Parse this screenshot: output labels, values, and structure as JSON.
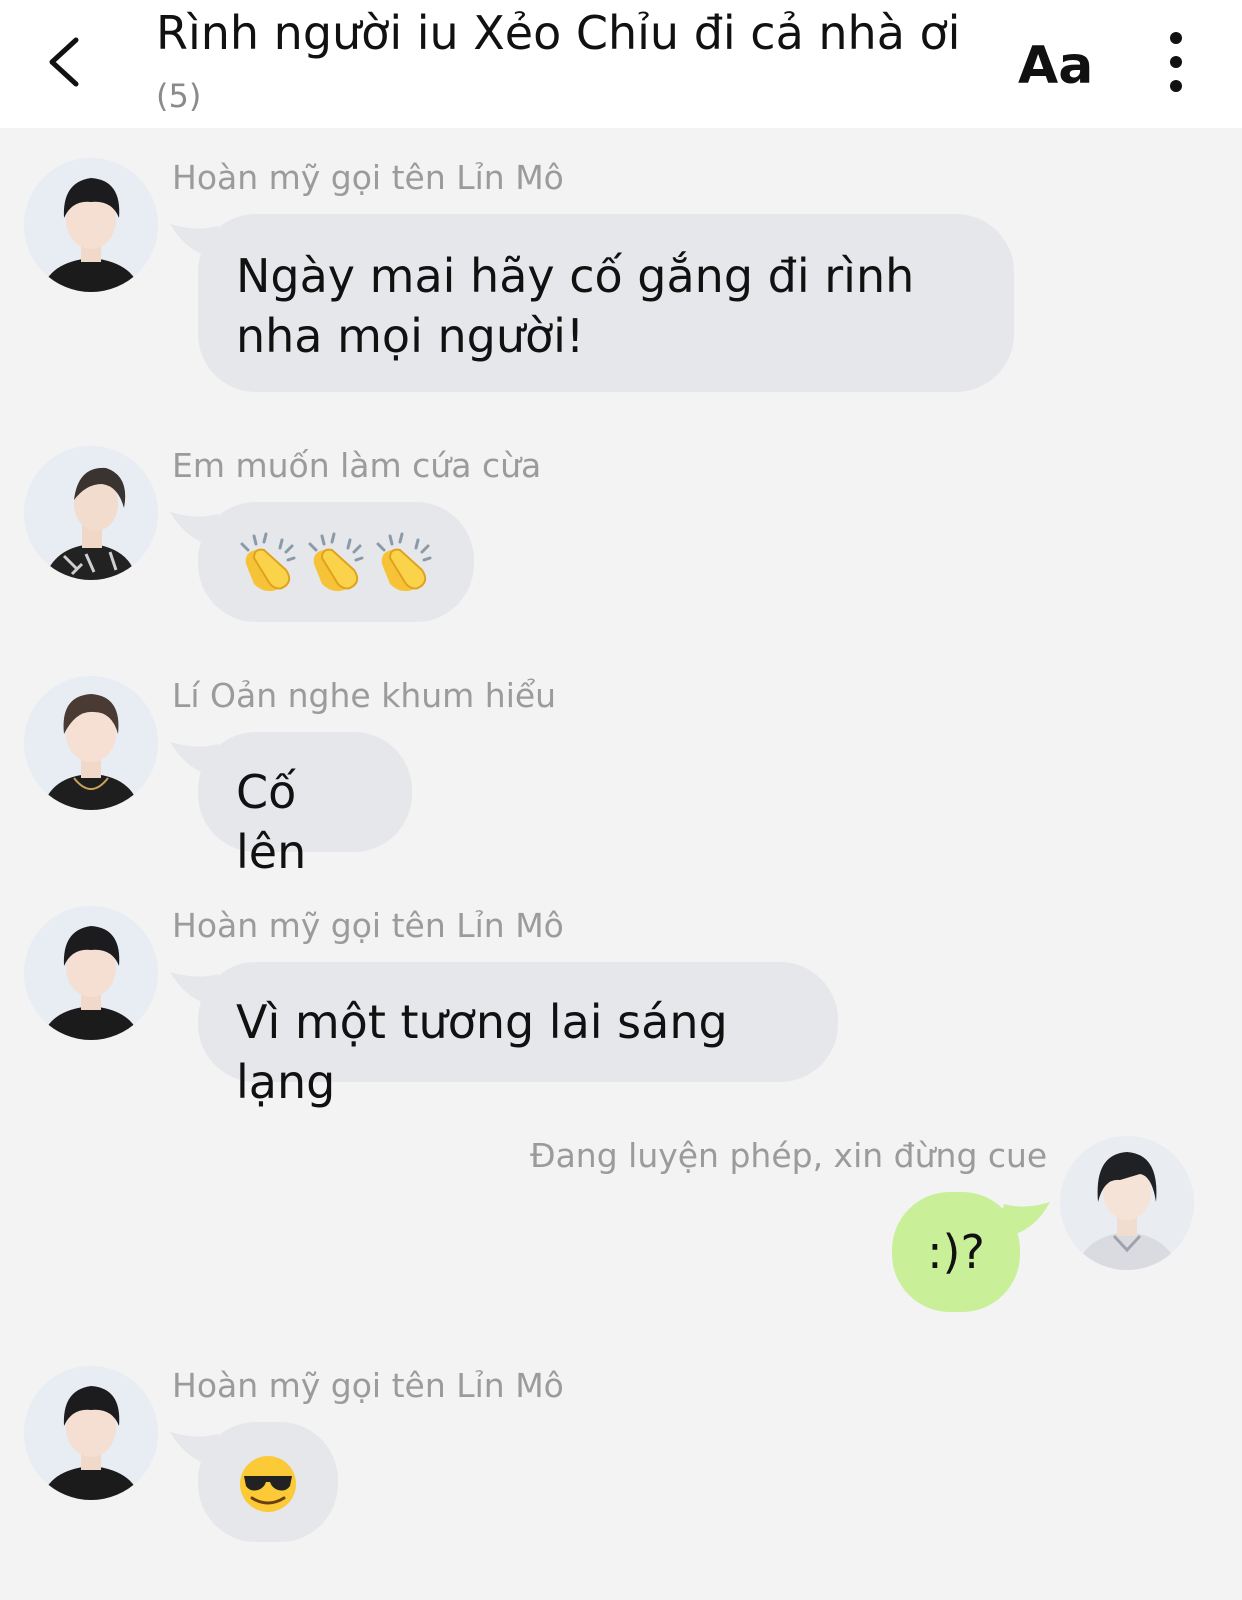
{
  "header": {
    "title": "Rình người iu Xẻo Chỉu đi cả nhà ơi",
    "member_count": "(5)",
    "font_button_label": "Aa"
  },
  "messages": [
    {
      "sender": "Hoàn mỹ gọi tên Lỉn Mô",
      "text": "Ngày mai hãy cố gắng đi rình nha mọi người!",
      "mine": false
    },
    {
      "sender": "Em muốn làm cứa cừa",
      "emoji": [
        "clapping-hands",
        "clapping-hands",
        "clapping-hands"
      ],
      "mine": false
    },
    {
      "sender": "Lí Oản nghe khum hiểu",
      "text": "Cố lên",
      "mine": false
    },
    {
      "sender": "Hoàn mỹ gọi tên Lỉn Mô",
      "text": "Vì một tương lai sáng lạng",
      "mine": false
    },
    {
      "sender": "Đang luyện phép, xin đừng cue",
      "text": ":)?",
      "mine": true
    },
    {
      "sender": "Hoàn mỹ gọi tên Lỉn Mô",
      "emoji": [
        "smiling-face-with-sunglasses"
      ],
      "mine": false
    }
  ],
  "colors": {
    "background": "#f3f3f3",
    "incoming_bubble": "#e5e7ea",
    "outgoing_bubble": "#c9ef98",
    "sender_name": "#9b9b9b"
  }
}
